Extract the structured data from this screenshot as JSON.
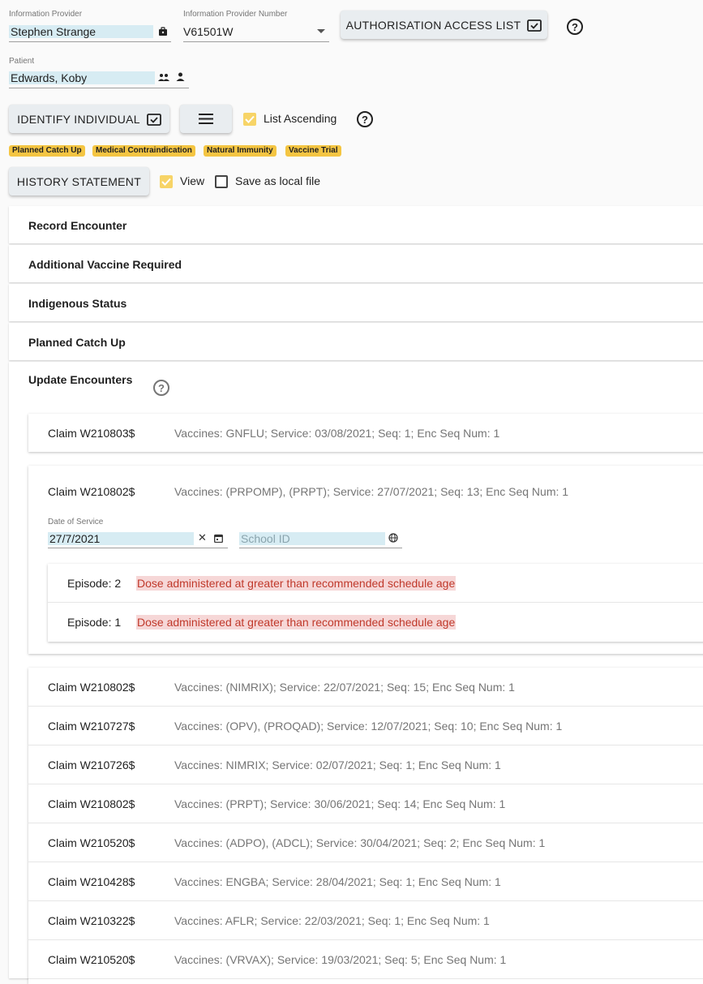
{
  "header": {
    "provider_label": "Information Provider",
    "provider_value": "Stephen Strange",
    "provider_number_label": "Information Provider Number",
    "provider_number_value": "V61501W",
    "auth_button": "AUTHORISATION ACCESS LIST",
    "patient_label": "Patient",
    "patient_value": "Edwards, Koby"
  },
  "toolbar": {
    "identify_button": "IDENTIFY INDIVIDUAL",
    "list_ascending_label": "List Ascending",
    "history_button": "HISTORY STATEMENT",
    "view_label": "View",
    "save_local_label": "Save as local file"
  },
  "tags": [
    "Planned Catch Up",
    "Medical Contraindication",
    "Natural Immunity",
    "Vaccine Trial"
  ],
  "panels": {
    "record_encounter": "Record Encounter",
    "additional_vaccine": "Additional Vaccine Required",
    "indigenous_status": "Indigenous Status",
    "planned_catch_up": "Planned Catch Up",
    "update_encounters": "Update Encounters"
  },
  "claims": {
    "first": {
      "id": "Claim W210803$",
      "desc": "Vaccines: GNFLU; Service: 03/08/2021; Seq: 1; Enc Seq Num: 1"
    },
    "expanded": {
      "id": "Claim W210802$",
      "desc": "Vaccines: (PRPOMP), (PRPT); Service: 27/07/2021; Seq: 13; Enc Seq Num: 1",
      "date_label": "Date of Service",
      "date_value": "27/7/2021",
      "school_placeholder": "School ID",
      "episodes": [
        {
          "label": "Episode: 2",
          "message": "Dose administered at greater than recommended schedule age"
        },
        {
          "label": "Episode: 1",
          "message": "Dose administered at greater than recommended schedule age"
        }
      ]
    },
    "list": [
      {
        "id": "Claim W210802$",
        "desc": "Vaccines: (NIMRIX); Service: 22/07/2021; Seq: 15; Enc Seq Num: 1"
      },
      {
        "id": "Claim W210727$",
        "desc": "Vaccines: (OPV), (PROQAD); Service: 12/07/2021; Seq: 10; Enc Seq Num: 1"
      },
      {
        "id": "Claim W210726$",
        "desc": "Vaccines: NIMRIX; Service: 02/07/2021; Seq: 1; Enc Seq Num: 1"
      },
      {
        "id": "Claim W210802$",
        "desc": "Vaccines: (PRPT); Service: 30/06/2021; Seq: 14; Enc Seq Num: 1"
      },
      {
        "id": "Claim W210520$",
        "desc": "Vaccines: (ADPO), (ADCL); Service: 30/04/2021; Seq: 2; Enc Seq Num: 1"
      },
      {
        "id": "Claim W210428$",
        "desc": "Vaccines: ENGBA; Service: 28/04/2021; Seq: 1; Enc Seq Num: 1"
      },
      {
        "id": "Claim W210322$",
        "desc": "Vaccines: AFLR; Service: 22/03/2021; Seq: 1; Enc Seq Num: 1"
      },
      {
        "id": "Claim W210520$",
        "desc": "Vaccines: (VRVAX); Service: 19/03/2021; Seq: 5; Enc Seq Num: 1"
      }
    ]
  },
  "icons": {
    "help": "?",
    "clear": "✕"
  }
}
